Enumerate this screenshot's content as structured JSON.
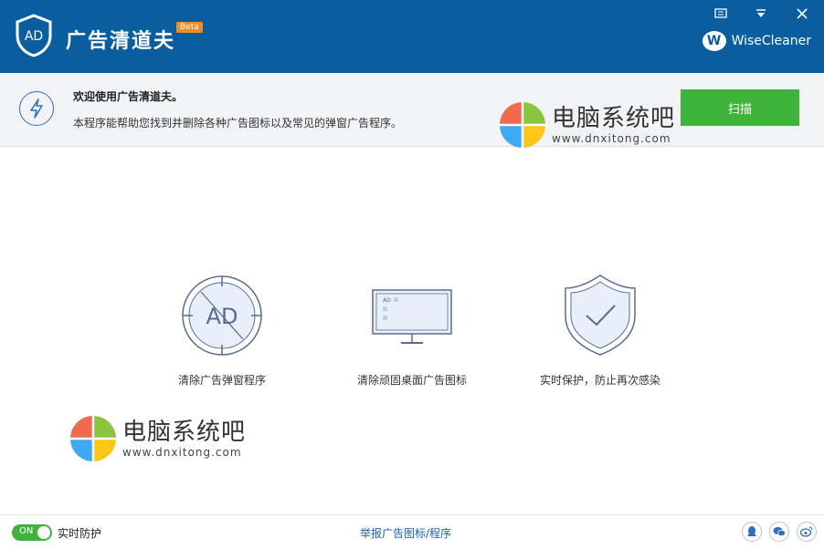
{
  "app": {
    "logo_text": "AD",
    "title": "广告清道夫",
    "beta_badge": "Beta",
    "brand": "WiseCleaner",
    "brand_logo": "W"
  },
  "window_controls": [
    "menu-icon",
    "dropdown-icon",
    "close-icon"
  ],
  "banner": {
    "welcome": "欢迎使用广告清道夫。",
    "description": "本程序能帮助您找到并删除各种广告图标以及常见的弹窗广告程序。",
    "scan_button": "扫描"
  },
  "features": [
    {
      "icon": "ad-block-icon",
      "label": "清除广告弹窗程序",
      "icon_text": "AD"
    },
    {
      "icon": "monitor-icon",
      "label": "清除顽固桌面广告图标",
      "icon_text": "AD"
    },
    {
      "icon": "shield-check-icon",
      "label": "实时保护，防止再次感染"
    }
  ],
  "watermark": {
    "name": "电脑系统吧",
    "url": "www.dnxitong.com"
  },
  "bottom": {
    "toggle_state": "ON",
    "realtime_label": "实时防护",
    "report_link": "举报广告图标/程序",
    "social_icons": [
      "qq-icon",
      "wechat-icon",
      "weibo-icon"
    ]
  },
  "colors": {
    "titlebar": "#0a5ea0",
    "scan_button": "#3fb33b",
    "toggle_on": "#3fb33b",
    "link": "#1c5fb0"
  }
}
